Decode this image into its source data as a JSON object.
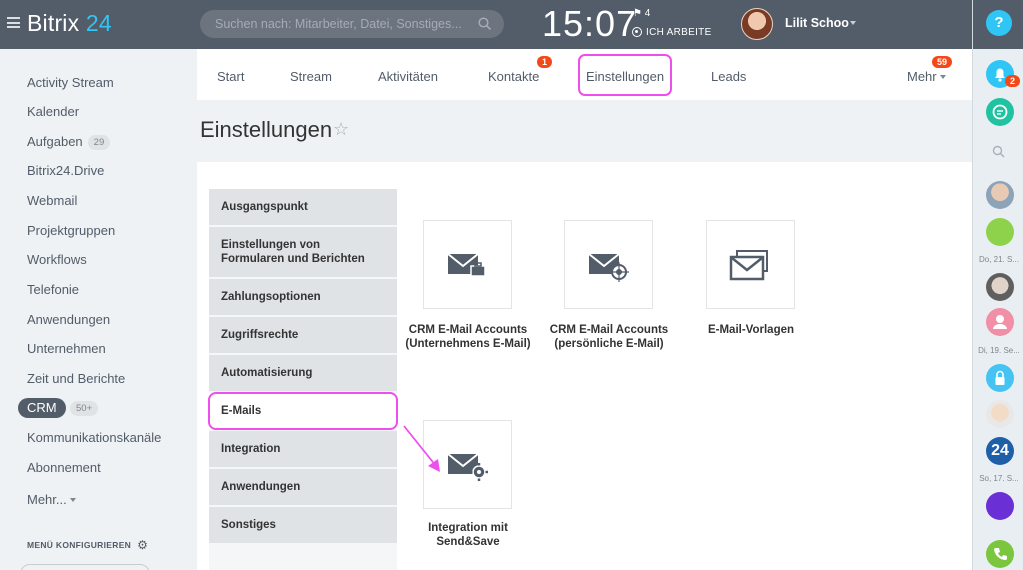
{
  "header": {
    "logo_text": "Bitrix",
    "logo_num": "24",
    "search_placeholder": "Suchen nach: Mitarbeiter, Datei, Sonstiges...",
    "time": "15:07",
    "flag_count": "4",
    "work_status": "ICH ARBEITE",
    "user_name": "Lilit Schoo"
  },
  "left_menu": {
    "items": [
      {
        "label": "Activity Stream"
      },
      {
        "label": "Kalender"
      },
      {
        "label": "Aufgaben",
        "counter": "29"
      },
      {
        "label": "Bitrix24.Drive"
      },
      {
        "label": "Webmail"
      },
      {
        "label": "Projektgruppen"
      },
      {
        "label": "Workflows"
      },
      {
        "label": "Telefonie"
      },
      {
        "label": "Anwendungen"
      },
      {
        "label": "Unternehmen"
      },
      {
        "label": "Zeit und Berichte"
      }
    ],
    "crm_label": "CRM",
    "crm_counter": "50+",
    "after_crm": [
      {
        "label": "Kommunikationskanäle"
      },
      {
        "label": "Abonnement"
      },
      {
        "label": "Mehr..."
      }
    ],
    "configure": "MENÜ KONFIGURIEREN"
  },
  "tabs": [
    {
      "label": "Start"
    },
    {
      "label": "Stream"
    },
    {
      "label": "Aktivitäten"
    },
    {
      "label": "Kontakte",
      "badge": "1"
    },
    {
      "label": "Einstellungen"
    },
    {
      "label": "Leads"
    },
    {
      "label": "Mehr",
      "badge": "59"
    }
  ],
  "page_title": "Einstellungen",
  "settings_nav": [
    {
      "label": "Ausgangspunkt"
    },
    {
      "label": "Einstellungen von Formularen und Berichten"
    },
    {
      "label": "Zahlungsoptionen"
    },
    {
      "label": "Zugriffsrechte"
    },
    {
      "label": "Automatisierung"
    },
    {
      "label": "E-Mails",
      "active": true
    },
    {
      "label": "Integration"
    },
    {
      "label": "Anwendungen"
    },
    {
      "label": "Sonstiges"
    }
  ],
  "tiles": [
    {
      "label": "CRM E-Mail Accounts (Unternehmens E-Mail)",
      "icon": "mail-briefcase-icon"
    },
    {
      "label": "CRM E-Mail Accounts (persönliche E-Mail)",
      "icon": "mail-target-icon"
    },
    {
      "label": "E-Mail-Vorlagen",
      "icon": "mail-templates-icon"
    },
    {
      "label": "Integration mit Send&Save",
      "icon": "mail-gear-icon"
    }
  ],
  "right_bar": {
    "notification_badge": "2",
    "dates": [
      "Do, 21. S...",
      "Di, 19. Se...",
      "So, 17. S..."
    ]
  },
  "colors": {
    "header_bg": "#535c69",
    "accent": "#2fc6f6",
    "highlight": "#ed4fed",
    "badge": "#f54819"
  }
}
